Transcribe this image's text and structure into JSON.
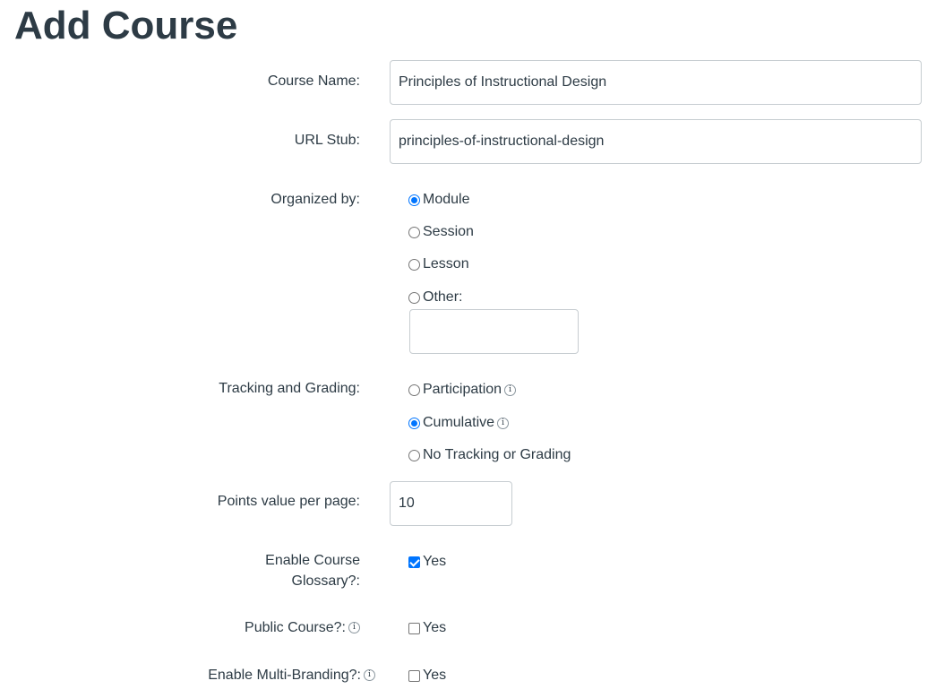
{
  "page": {
    "title": "Add Course"
  },
  "course_name": {
    "label": "Course Name:",
    "value": "Principles of Instructional Design"
  },
  "url_stub": {
    "label": "URL Stub:",
    "value": "principles-of-instructional-design"
  },
  "organized_by": {
    "label": "Organized by:",
    "options": [
      {
        "label": "Module",
        "checked": true
      },
      {
        "label": "Session",
        "checked": false
      },
      {
        "label": "Lesson",
        "checked": false
      },
      {
        "label": "Other:",
        "checked": false
      }
    ],
    "other_value": ""
  },
  "tracking": {
    "label": "Tracking and Grading:",
    "options": [
      {
        "label": "Participation",
        "checked": false,
        "info_icon": "info-icon"
      },
      {
        "label": "Cumulative",
        "checked": true,
        "info_icon": "info-icon"
      },
      {
        "label": "No Tracking or Grading",
        "checked": false
      }
    ]
  },
  "points": {
    "label": "Points value per page:",
    "value": "10"
  },
  "glossary": {
    "label": "Enable Course Glossary?:",
    "option_label": "Yes",
    "checked": true
  },
  "public_course": {
    "label": "Public Course?:",
    "option_label": "Yes",
    "checked": false,
    "info_icon": "info-icon"
  },
  "multi_branding": {
    "label": "Enable Multi-Branding?:",
    "option_label": "Yes",
    "checked": false,
    "info_icon": "info-icon"
  },
  "colors": {
    "accent": "#0075ff",
    "text": "#2d3b45",
    "border": "#c7cdd1"
  }
}
